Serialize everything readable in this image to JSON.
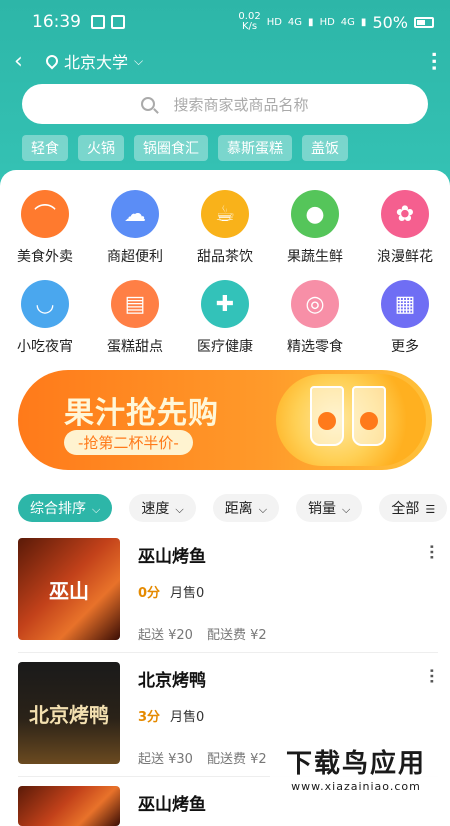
{
  "status": {
    "time": "16:39",
    "speed": "0.02",
    "speed_unit": "K/s",
    "hd1": "HD",
    "net1": "4G",
    "hd2": "HD",
    "net2": "4G",
    "battery": "50%"
  },
  "topbar": {
    "back_icon": "back-arrow-icon",
    "location": "北京大学"
  },
  "search": {
    "placeholder": "搜索商家或商品名称"
  },
  "tags": [
    "轻食",
    "火锅",
    "锅圈食汇",
    "慕斯蛋糕",
    "盖饭"
  ],
  "categories": [
    {
      "label": "美食外卖",
      "icon": "cloche-icon",
      "glyph": "⌒",
      "color": "#ff7a2e"
    },
    {
      "label": "商超便利",
      "icon": "cupcake-icon",
      "glyph": "☁",
      "color": "#5b8df6"
    },
    {
      "label": "甜品茶饮",
      "icon": "cup-icon",
      "glyph": "☕",
      "color": "#f9b21a"
    },
    {
      "label": "果蔬生鲜",
      "icon": "tomato-icon",
      "glyph": "●",
      "color": "#55c55a"
    },
    {
      "label": "浪漫鲜花",
      "icon": "flower-pot-icon",
      "glyph": "✿",
      "color": "#f55f8f"
    },
    {
      "label": "小吃夜宵",
      "icon": "noodle-bowl-icon",
      "glyph": "◡",
      "color": "#4aa7ee"
    },
    {
      "label": "蛋糕甜点",
      "icon": "cake-icon",
      "glyph": "▤",
      "color": "#ff7f45"
    },
    {
      "label": "医疗健康",
      "icon": "first-aid-kit-icon",
      "glyph": "✚",
      "color": "#33c2b9"
    },
    {
      "label": "精选零食",
      "icon": "lollipop-icon",
      "glyph": "◎",
      "color": "#f78fa7"
    },
    {
      "label": "更多",
      "icon": "grid-icon",
      "glyph": "▦",
      "color": "#6f6ef4"
    }
  ],
  "banner": {
    "title": "果汁抢先购",
    "subtitle": "-抢第二杯半价-"
  },
  "sorts": [
    {
      "label": "综合排序",
      "suffix": "⌵",
      "active": true
    },
    {
      "label": "速度",
      "suffix": "⌵",
      "active": false
    },
    {
      "label": "距离",
      "suffix": "⌵",
      "active": false
    },
    {
      "label": "销量",
      "suffix": "⌵",
      "active": false
    },
    {
      "label": "全部",
      "suffix": "☰",
      "active": false
    }
  ],
  "shops": [
    {
      "name": "巫山烤鱼",
      "rating": "0分",
      "sales": "月售0",
      "min_order": "起送 ¥20",
      "delivery_fee": "配送费 ¥2",
      "thumb_text": "巫山"
    },
    {
      "name": "北京烤鸭",
      "rating": "3分",
      "sales": "月售0",
      "min_order": "起送 ¥30",
      "delivery_fee": "配送费 ¥2",
      "thumb_text": "北京烤鸭"
    },
    {
      "name": "巫山烤鱼",
      "rating": "",
      "sales": "",
      "min_order": "",
      "delivery_fee": "",
      "thumb_text": ""
    }
  ],
  "watermark": {
    "main": "下载鸟应用",
    "sub": "www.xiazainiao.com"
  }
}
